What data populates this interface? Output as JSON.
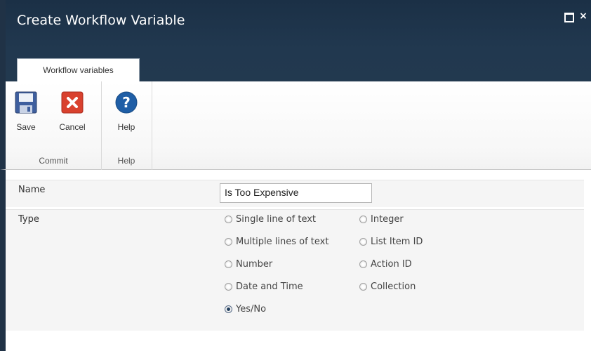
{
  "window": {
    "title": "Create Workflow Variable",
    "maximize_label": "",
    "close_label": "×"
  },
  "ribbon": {
    "tab_label": "Workflow variables",
    "groups": [
      {
        "label": "Commit",
        "buttons": [
          {
            "label": "Save",
            "icon": "save-icon"
          },
          {
            "label": "Cancel",
            "icon": "cancel-icon"
          }
        ]
      },
      {
        "label": "Help",
        "buttons": [
          {
            "label": "Help",
            "icon": "help-icon"
          }
        ]
      }
    ]
  },
  "form": {
    "name_label": "Name",
    "name_value": "Is Too Expensive",
    "type_label": "Type",
    "type_options": [
      {
        "label": "Single line of text",
        "checked": false
      },
      {
        "label": "Integer",
        "checked": false
      },
      {
        "label": "Multiple lines of text",
        "checked": false
      },
      {
        "label": "List Item ID",
        "checked": false
      },
      {
        "label": "Number",
        "checked": false
      },
      {
        "label": "Action ID",
        "checked": false
      },
      {
        "label": "Date and Time",
        "checked": false
      },
      {
        "label": "Collection",
        "checked": false
      },
      {
        "label": "Yes/No",
        "checked": true
      }
    ]
  },
  "colors": {
    "title_bar": "#21384f",
    "ribbon_bg": "#f7f7f7",
    "form_row_bg": "#f5f5f5"
  }
}
